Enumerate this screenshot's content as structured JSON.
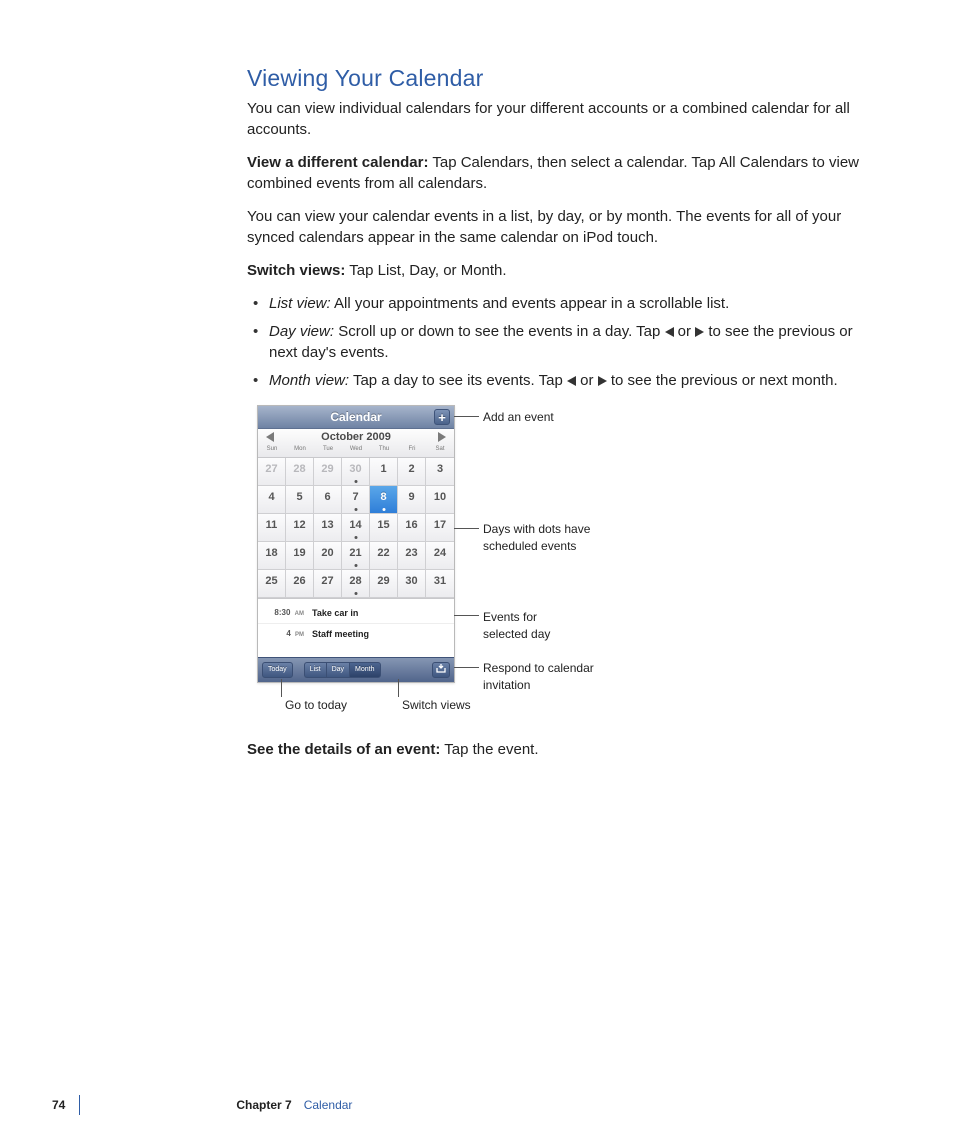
{
  "heading": "Viewing Your Calendar",
  "intro": "You can view individual calendars for your different accounts or a combined calendar for all accounts.",
  "view_diff": {
    "lead": "View a different calendar:",
    "body": "  Tap Calendars, then select a calendar. Tap All Calendars to view combined events from all calendars."
  },
  "para2": "You can view your calendar events in a list, by day, or by month. The events for all of your synced calendars appear in the same calendar on iPod touch.",
  "switch_lead": "Switch views:",
  "switch_body": "  Tap List, Day, or Month.",
  "bullets": {
    "list": {
      "lead": "List view:",
      "body": "  All your appointments and events appear in a scrollable list."
    },
    "day": {
      "lead": "Day view:",
      "body1": "  Scroll up or down to see the events in a day. Tap ",
      "body2": " or ",
      "body3": " to see the previous or next day's events."
    },
    "month": {
      "lead": "Month view:",
      "body1": "  Tap a day to see its events. Tap ",
      "body2": " or ",
      "body3": " to see the previous or next month."
    }
  },
  "see_lead": "See the details of an event:",
  "see_body": "  Tap the event.",
  "figure": {
    "titlebar": "Calendar",
    "month": "October 2009",
    "dow": [
      "Sun",
      "Mon",
      "Tue",
      "Wed",
      "Thu",
      "Fri",
      "Sat"
    ],
    "cells": [
      {
        "n": "27",
        "dim": true
      },
      {
        "n": "28",
        "dim": true
      },
      {
        "n": "29",
        "dim": true
      },
      {
        "n": "30",
        "dim": true,
        "dot": true
      },
      {
        "n": "1"
      },
      {
        "n": "2"
      },
      {
        "n": "3"
      },
      {
        "n": "4"
      },
      {
        "n": "5"
      },
      {
        "n": "6"
      },
      {
        "n": "7",
        "dot": true
      },
      {
        "n": "8",
        "sel": true,
        "dot": true
      },
      {
        "n": "9"
      },
      {
        "n": "10"
      },
      {
        "n": "11"
      },
      {
        "n": "12"
      },
      {
        "n": "13"
      },
      {
        "n": "14",
        "dot": true
      },
      {
        "n": "15"
      },
      {
        "n": "16"
      },
      {
        "n": "17"
      },
      {
        "n": "18"
      },
      {
        "n": "19"
      },
      {
        "n": "20"
      },
      {
        "n": "21",
        "dot": true
      },
      {
        "n": "22"
      },
      {
        "n": "23"
      },
      {
        "n": "24"
      },
      {
        "n": "25"
      },
      {
        "n": "26"
      },
      {
        "n": "27"
      },
      {
        "n": "28",
        "dot": true
      },
      {
        "n": "29"
      },
      {
        "n": "30"
      },
      {
        "n": "31"
      }
    ],
    "events": [
      {
        "time": "8:30",
        "ampm": "AM",
        "title": "Take car in"
      },
      {
        "time": "4",
        "ampm": "PM",
        "title": "Staff meeting"
      }
    ],
    "toolbar": {
      "today": "Today",
      "list": "List",
      "day": "Day",
      "month": "Month"
    }
  },
  "callouts": {
    "add": "Add an event",
    "dots": "Days with dots have scheduled events",
    "events": "Events for selected day",
    "respond": "Respond to calendar invitation",
    "today": "Go to today",
    "switch": "Switch views"
  },
  "footer": {
    "page": "74",
    "chapter": "Chapter 7",
    "title": "Calendar"
  }
}
